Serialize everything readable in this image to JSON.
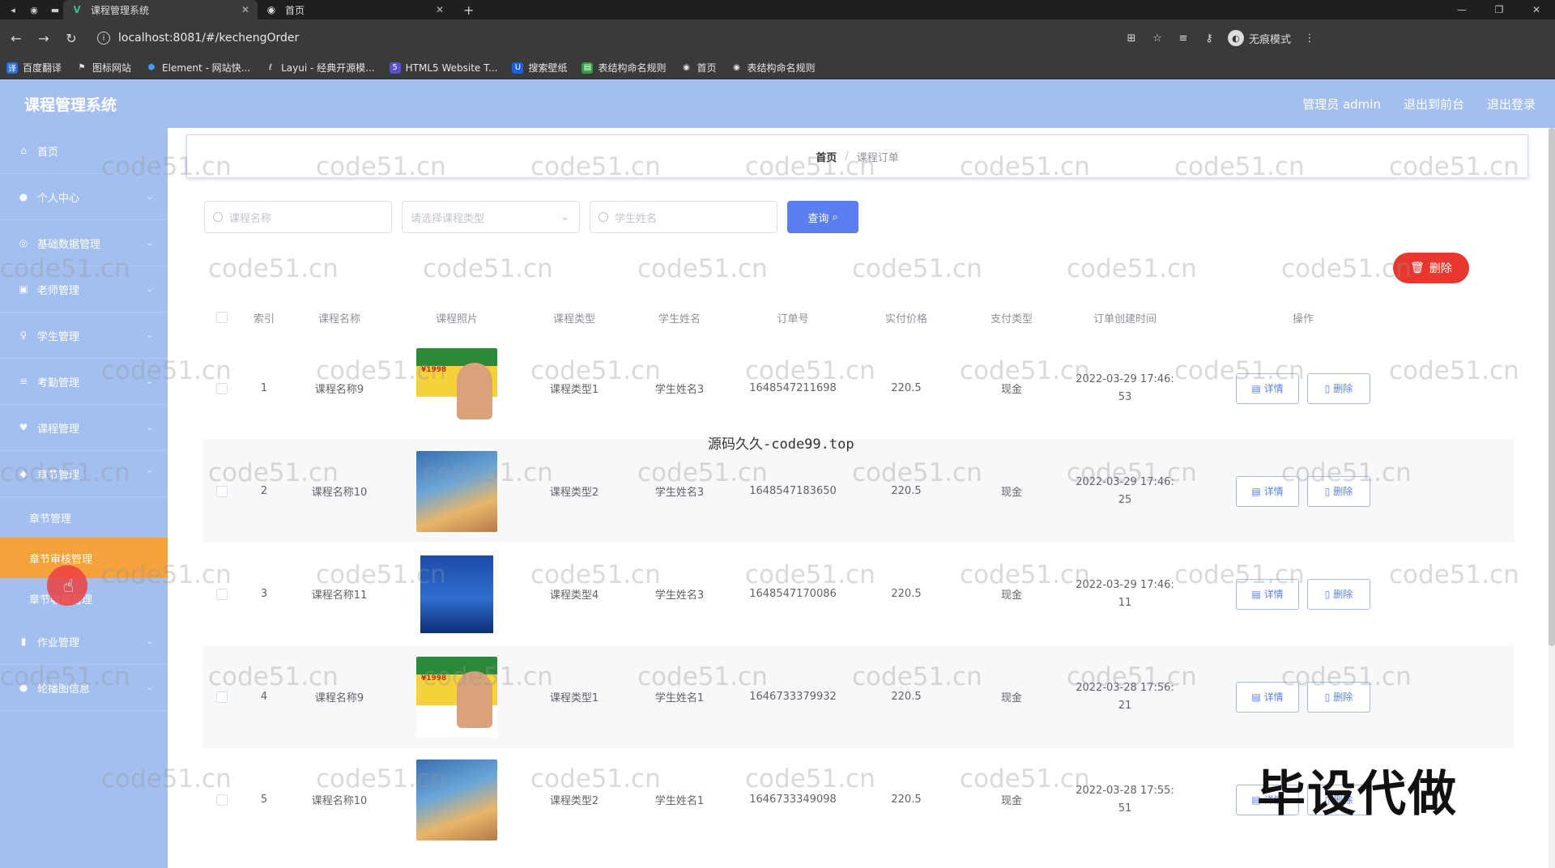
{
  "browser": {
    "tabs": [
      {
        "title": "课程管理系统",
        "icon": "vue-icon",
        "active": true
      },
      {
        "title": "首页",
        "icon": "globe-icon",
        "active": false
      }
    ],
    "url": "localhost:8081/#/kechengOrder",
    "profile_label": "无痕模式",
    "bookmarks": [
      "百度翻译",
      "图标网站",
      "Element - 网站快...",
      "Layui - 经典开源模...",
      "HTML5 Website T...",
      "搜索壁纸",
      "表结构命名规则",
      "首页",
      "表结构命名规则"
    ]
  },
  "header": {
    "title": "课程管理系统",
    "admin_label": "管理员 admin",
    "back_label": "退出到前台",
    "logout_label": "退出登录"
  },
  "sidebar": {
    "items": [
      {
        "label": "首页",
        "icon": "home-icon"
      },
      {
        "label": "个人中心",
        "icon": "user-icon"
      },
      {
        "label": "基础数据管理",
        "icon": "database-icon"
      },
      {
        "label": "老师管理",
        "icon": "teacher-icon"
      },
      {
        "label": "学生管理",
        "icon": "student-icon"
      },
      {
        "label": "考勤管理",
        "icon": "list-icon"
      },
      {
        "label": "课程管理",
        "icon": "book-icon"
      },
      {
        "label": "章节管理",
        "icon": "chapter-icon"
      }
    ],
    "sub_items": [
      {
        "label": "章节管理",
        "active": false
      },
      {
        "label": "章节审核管理",
        "active": true
      },
      {
        "label": "章节收藏管理",
        "active": false
      }
    ],
    "more_items": [
      {
        "label": "作业管理",
        "icon": "chart-icon"
      },
      {
        "label": "轮播图信息",
        "icon": "image-icon"
      }
    ]
  },
  "breadcrumb": {
    "home": "首页",
    "current": "课程订单"
  },
  "search": {
    "course_name_placeholder": "课程名称",
    "course_type_placeholder": "请选择课程类型",
    "student_name_placeholder": "学生姓名",
    "query_label": "查询"
  },
  "delete_label": "删除",
  "table": {
    "headers": [
      "索引",
      "课程名称",
      "课程照片",
      "课程类型",
      "学生姓名",
      "订单号",
      "实付价格",
      "支付类型",
      "订单创建时间",
      "操作"
    ],
    "detail_label": "详情",
    "delete_label": "删除",
    "rows": [
      {
        "index": "1",
        "course": "课程名称9",
        "type": "课程类型1",
        "student": "学生姓名3",
        "order_no": "1648547211698",
        "price": "220.5",
        "pay": "现金",
        "time_a": "2022-03-29 17:46:",
        "time_b": "53",
        "photo": "t1"
      },
      {
        "index": "2",
        "course": "课程名称10",
        "type": "课程类型2",
        "student": "学生姓名3",
        "order_no": "1648547183650",
        "price": "220.5",
        "pay": "现金",
        "time_a": "2022-03-29 17:46:",
        "time_b": "25",
        "photo": "t2"
      },
      {
        "index": "3",
        "course": "课程名称11",
        "type": "课程类型4",
        "student": "学生姓名3",
        "order_no": "1648547170086",
        "price": "220.5",
        "pay": "现金",
        "time_a": "2022-03-29 17:46:",
        "time_b": "11",
        "photo": "t3"
      },
      {
        "index": "4",
        "course": "课程名称9",
        "type": "课程类型1",
        "student": "学生姓名1",
        "order_no": "1646733379932",
        "price": "220.5",
        "pay": "现金",
        "time_a": "2022-03-28 17:56:",
        "time_b": "21",
        "photo": "t1"
      },
      {
        "index": "5",
        "course": "课程名称10",
        "type": "课程类型2",
        "student": "学生姓名1",
        "order_no": "1646733349098",
        "price": "220.5",
        "pay": "现金",
        "time_a": "2022-03-28 17:55:",
        "time_b": "51",
        "photo": "t2"
      }
    ]
  },
  "overlay": {
    "watermark": "code51.cn",
    "center_mark": "源码久久-code99.top",
    "big_stamp": "毕设代做",
    "book_price_text": "¥1998"
  }
}
